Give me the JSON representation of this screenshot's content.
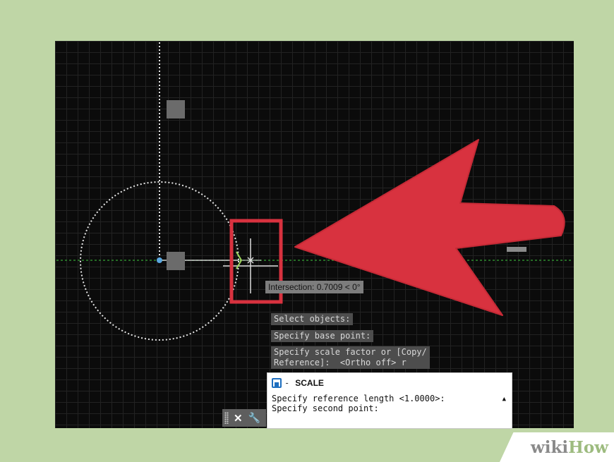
{
  "drawing": {
    "tooltip_text": "Intersection: 0.7009 < 0°",
    "highlight_color": "#d8323f",
    "arrow_color": "#d8323f",
    "axis_color": "#2e8b2e",
    "grid_color": "#222222",
    "background_color": "#0b0b0b"
  },
  "prompts": {
    "line1": "Select objects:",
    "line2": "Specify base point:",
    "line3": "Specify scale factor or [Copy/\nReference]:  <Ortho off> r"
  },
  "command_panel": {
    "icon": "command-icon",
    "dash": "-",
    "command_name": "SCALE",
    "line1": "Specify reference length <1.0000>:",
    "line2": "Specify second point:",
    "scroll_icon": "triangle-up-icon"
  },
  "toolbar": {
    "close_icon": "close-icon",
    "wrench_icon": "wrench-icon",
    "close_label": "✕",
    "wrench_label": "🔧"
  },
  "watermark": {
    "part1": "wiki",
    "part2": "How"
  }
}
